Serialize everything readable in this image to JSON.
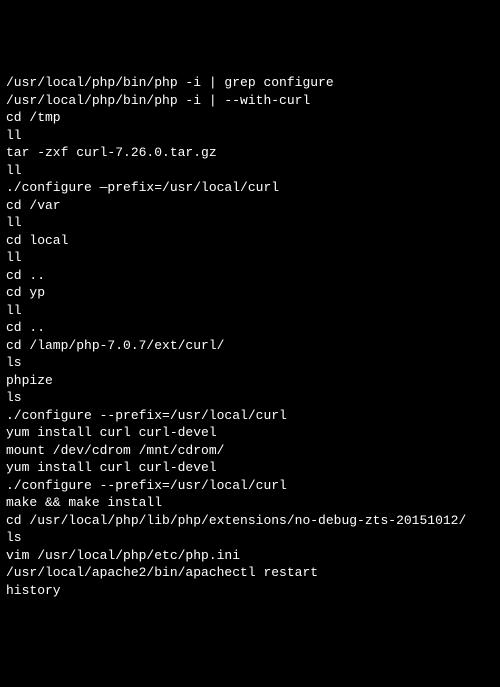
{
  "terminal": {
    "lines": [
      "/usr/local/php/bin/php -i | grep configure",
      "/usr/local/php/bin/php -i | --with-curl",
      "cd /tmp",
      "ll",
      "tar -zxf curl-7.26.0.tar.gz",
      "ll",
      "./configure —prefix=/usr/local/curl",
      "cd /var",
      "ll",
      "cd local",
      "ll",
      "cd ..",
      "cd yp",
      "ll",
      "cd ..",
      "cd /lamp/php-7.0.7/ext/curl/",
      "ls",
      "phpize",
      "ls",
      "./configure --prefix=/usr/local/curl",
      "yum install curl curl-devel",
      "mount /dev/cdrom /mnt/cdrom/",
      "yum install curl curl-devel",
      "./configure --prefix=/usr/local/curl",
      "make && make install",
      "cd /usr/local/php/lib/php/extensions/no-debug-zts-20151012/",
      "ls",
      "vim /usr/local/php/etc/php.ini",
      "/usr/local/apache2/bin/apachectl restart",
      "history"
    ]
  }
}
